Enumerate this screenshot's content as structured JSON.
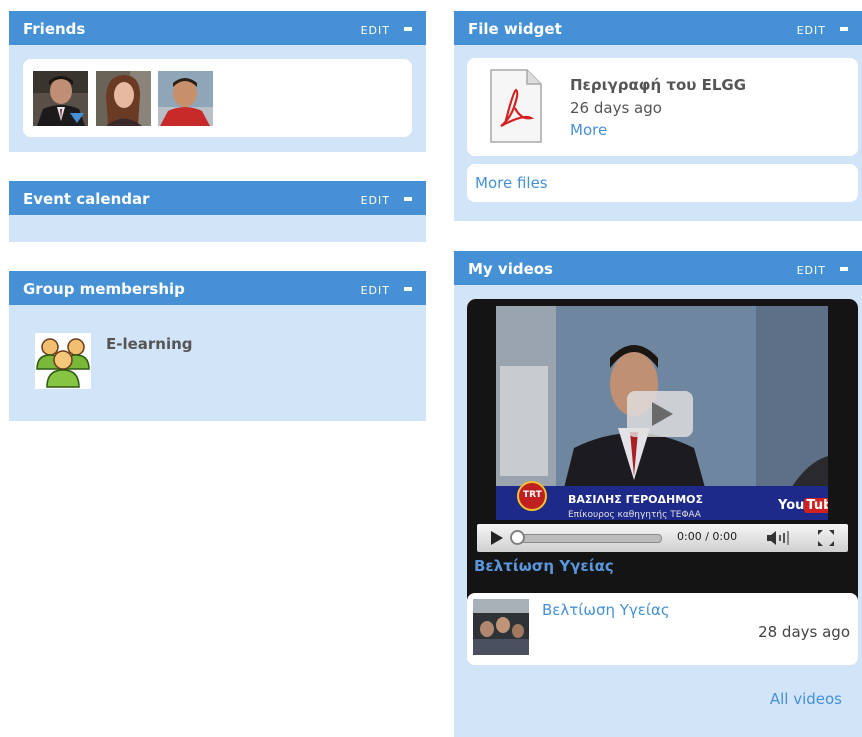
{
  "friends": {
    "title": "Friends",
    "edit": "EDIT"
  },
  "event_calendar": {
    "title": "Event calendar",
    "edit": "EDIT"
  },
  "group_membership": {
    "title": "Group membership",
    "edit": "EDIT",
    "group_name": "E-learning"
  },
  "file_widget": {
    "title": "File widget",
    "edit": "EDIT",
    "file_title": "Περιγραφή του ELGG",
    "file_time": "26 days ago",
    "more": "More",
    "more_files": "More files"
  },
  "my_videos": {
    "title": "My videos",
    "edit": "EDIT",
    "player": {
      "caption_name": "ΒΑΣΙΛΗΣ ΓΕΡΟΔΗΜΟΣ",
      "caption_sub": "Επίκουρος καθηγητής ΤΕΦΑΑ",
      "channel_logo": "TRT",
      "brand_you": "You",
      "brand_tube": "Tube",
      "time": "0:00 / 0:00",
      "video_title": "Βελτίωση Υγείας",
      "progress": 0
    },
    "item_title": "Βελτίωση Υγείας",
    "item_time": "28 days ago",
    "all_videos": "All videos"
  },
  "colors": {
    "header": "#4690d6",
    "panel": "#d2e4f8",
    "link": "#4690d6"
  }
}
